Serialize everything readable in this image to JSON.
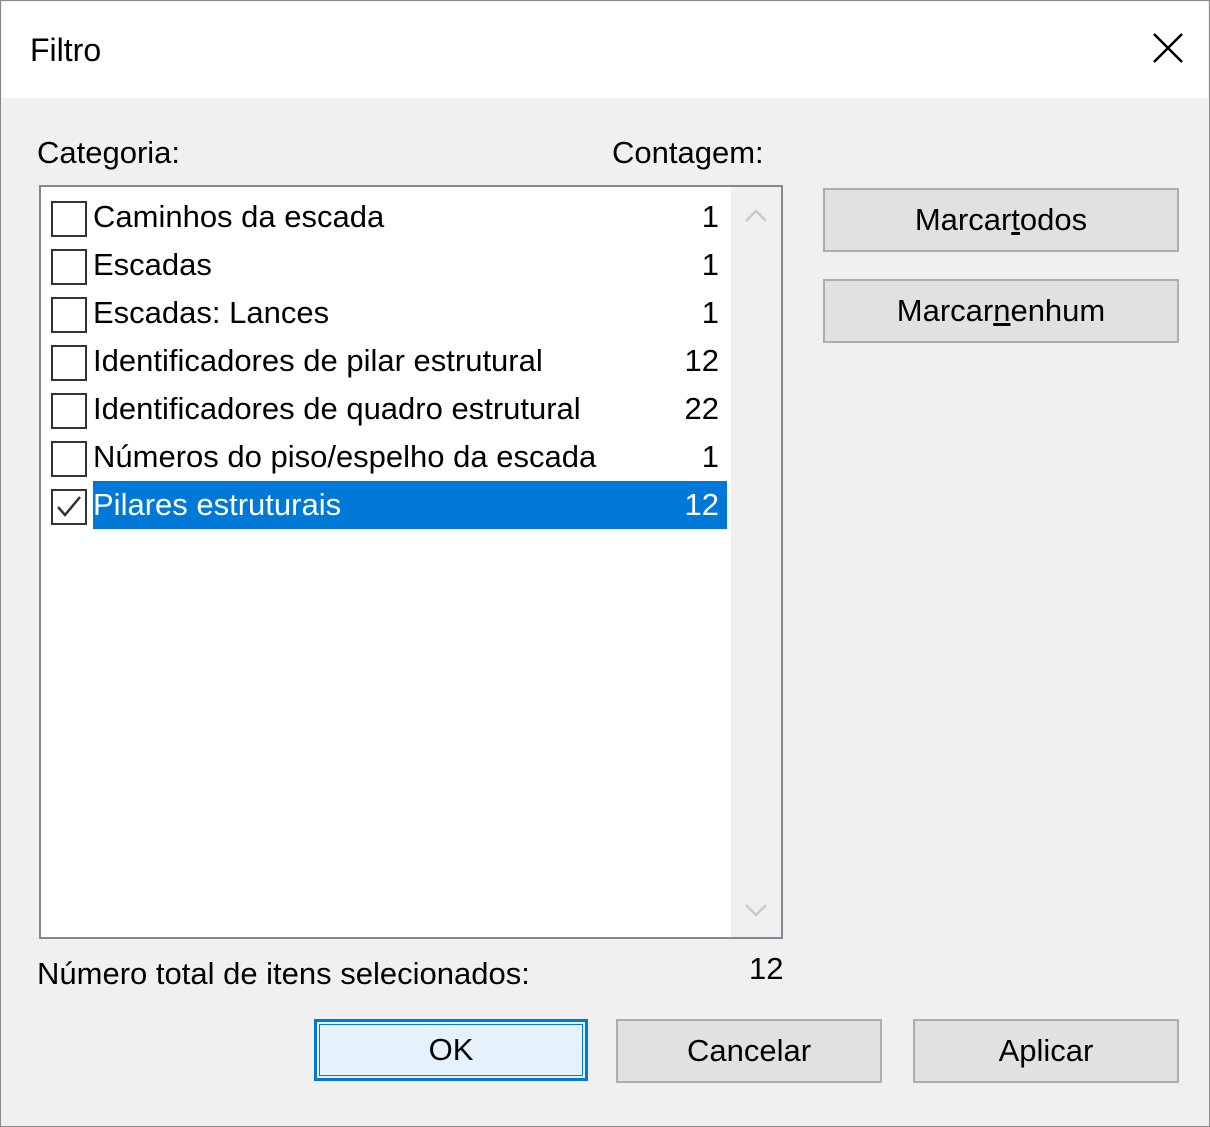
{
  "window": {
    "title": "Filtro",
    "close_icon": "close-icon"
  },
  "labels": {
    "category": "Categoria:",
    "count": "Contagem:",
    "total": "Número total de itens selecionados:",
    "total_value": "12"
  },
  "list": {
    "items": [
      {
        "name": "Caminhos da escada",
        "count": "1",
        "checked": false,
        "selected": false
      },
      {
        "name": "Escadas",
        "count": "1",
        "checked": false,
        "selected": false
      },
      {
        "name": "Escadas: Lances",
        "count": "1",
        "checked": false,
        "selected": false
      },
      {
        "name": "Identificadores de pilar estrutural",
        "count": "12",
        "checked": false,
        "selected": false
      },
      {
        "name": "Identificadores de quadro estrutural",
        "count": "22",
        "checked": false,
        "selected": false
      },
      {
        "name": "Números do piso/espelho da escada",
        "count": "1",
        "checked": false,
        "selected": false
      },
      {
        "name": "Pilares estruturais",
        "count": "12",
        "checked": true,
        "selected": true
      }
    ]
  },
  "buttons": {
    "check_all": {
      "before": "Marcar ",
      "mnemonic": "t",
      "after": "odos"
    },
    "check_none": {
      "before": "Marcar ",
      "mnemonic": "n",
      "after": "enhum"
    },
    "ok": "OK",
    "cancel": "Cancelar",
    "apply": "Aplicar"
  },
  "colors": {
    "selection": "#0078d7",
    "default_button_border": "#0078d7"
  }
}
